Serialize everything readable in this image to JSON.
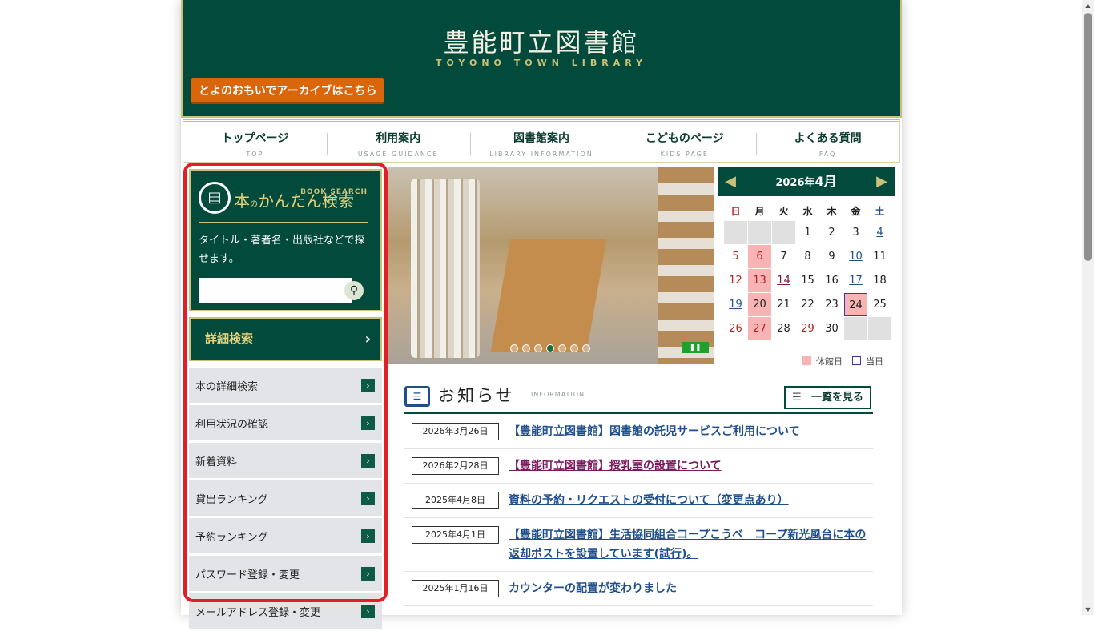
{
  "header": {
    "logo_jp": "豊能町立図書館",
    "logo_en": "TOYONO TOWN LIBRARY",
    "archive_label": "とよのおもいでアーカイブはこちら"
  },
  "nav": [
    {
      "jp": "トップページ",
      "en": "TOP"
    },
    {
      "jp": "利用案内",
      "en": "USAGE GUIDANCE"
    },
    {
      "jp": "図書館案内",
      "en": "LIBRARY INFORMATION"
    },
    {
      "jp": "こどものページ",
      "en": "KIDS PAGE"
    },
    {
      "jp": "よくある質問",
      "en": "FAQ"
    }
  ],
  "search": {
    "title_small": "本",
    "title_no": "の",
    "title_main": "かんたん検索",
    "title_en": "BOOK SEARCH",
    "description": "タイトル・著者名・出版社などで探せます。",
    "input_value": "",
    "detail_label": "詳細検索"
  },
  "side_menu": [
    "本の詳細検索",
    "利用状況の確認",
    "新着資料",
    "貸出ランキング",
    "予約ランキング",
    "パスワード登録・変更",
    "メールアドレス登録・変更"
  ],
  "calendar": {
    "year_label": "2026年",
    "month_label": "4月",
    "weekdays": [
      "日",
      "月",
      "火",
      "水",
      "木",
      "金",
      "土"
    ],
    "legend_closed": "休館日",
    "legend_today": "当日",
    "colors": {
      "closed": "#f8b4b4",
      "today_border": "#3a3c9c"
    }
  },
  "news": {
    "title": "お知らせ",
    "title_en": "INFORMATION",
    "see_all": "一覧を見る",
    "items": [
      {
        "date": "2026年3月26日",
        "text": "【豊能町立図書館】図書館の託児サービスご利用について"
      },
      {
        "date": "2026年2月28日",
        "text": "【豊能町立図書館】授乳室の設置について"
      },
      {
        "date": "2025年4月8日",
        "text": "資料の予約・リクエストの受付について（変更点あり）"
      },
      {
        "date": "2025年4月1日",
        "text": "【豊能町立図書館】生活協同組合コープこうべ　コープ新光風台に本の返却ポストを設置しています(試行)。"
      },
      {
        "date": "2025年1月16日",
        "text": "カウンターの配置が変わりました"
      }
    ]
  },
  "colors": {
    "brand_green": "#024b3c",
    "gold": "#c9c07a",
    "accent_orange": "#d9660a",
    "highlight_red": "#e21f26"
  }
}
